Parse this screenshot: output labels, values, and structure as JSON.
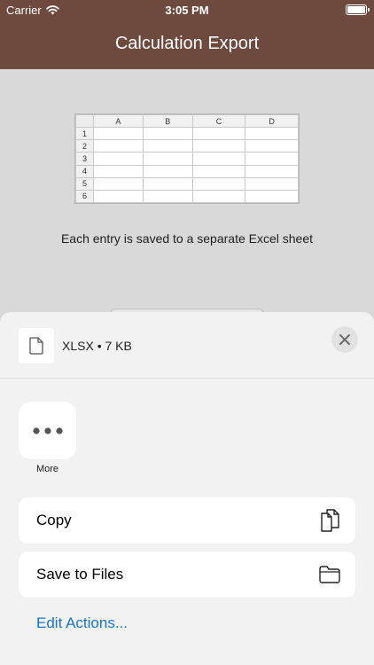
{
  "status": {
    "carrier": "Carrier",
    "time": "3:05 PM"
  },
  "nav": {
    "title": "Calculation Export"
  },
  "preview": {
    "columns": [
      "A",
      "B",
      "C",
      "D"
    ],
    "rows": [
      "1",
      "2",
      "3",
      "4",
      "5",
      "6"
    ]
  },
  "caption": "Each entry is saved to a separate Excel sheet",
  "share_sheet": {
    "file_info": "XLSX • 7 KB",
    "more_label": "More",
    "actions": [
      {
        "label": "Copy",
        "icon": "copy-icon"
      },
      {
        "label": "Save to Files",
        "icon": "folder-icon"
      }
    ],
    "edit_actions": "Edit Actions..."
  },
  "colors": {
    "nav_background": "#6e4a3e",
    "link": "#1a73c8"
  }
}
